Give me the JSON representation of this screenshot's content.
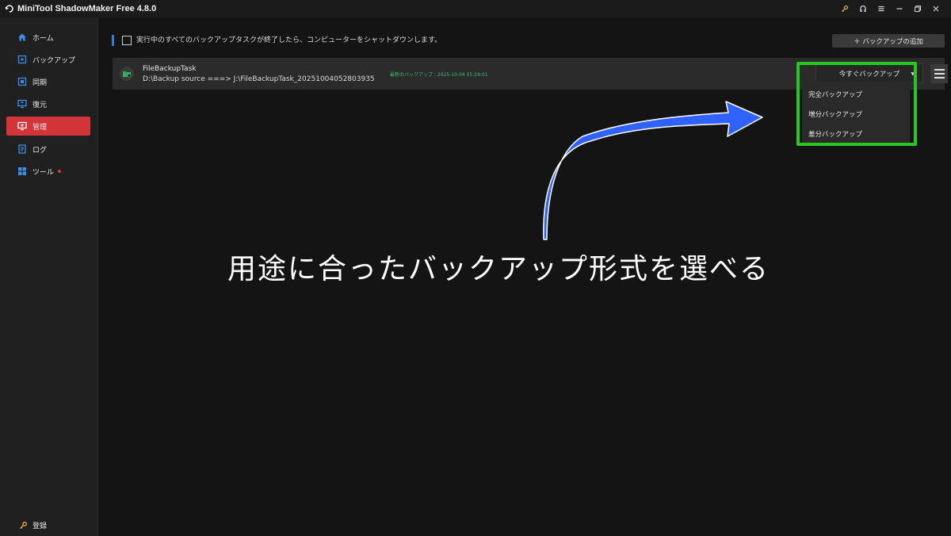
{
  "app": {
    "title": "MiniTool ShadowMaker Free 4.8.0"
  },
  "window_controls": [
    "key-icon",
    "account-icon",
    "menu-icon",
    "minimize-icon",
    "restore-icon",
    "close-icon"
  ],
  "sidebar": {
    "items": [
      {
        "label": "ホーム",
        "icon": "home-icon"
      },
      {
        "label": "バックアップ",
        "icon": "backup-icon"
      },
      {
        "label": "同期",
        "icon": "sync-icon"
      },
      {
        "label": "復元",
        "icon": "restore-icon"
      },
      {
        "label": "管理",
        "icon": "manage-icon",
        "active": true
      },
      {
        "label": "ログ",
        "icon": "log-icon"
      },
      {
        "label": "ツール",
        "icon": "tools-icon",
        "badge": true
      }
    ],
    "register_label": "登録"
  },
  "main": {
    "shutdown_label": "実行中のすべてのバックアップタスクが終了したら、コンピューターをシャットダウンします。",
    "add_backup_label": "＋ バックアップの追加",
    "task": {
      "name": "FileBackupTask",
      "path": "D:\\Backup source ===> J:\\FileBackupTask_20251004052803935",
      "last_backup": "最新のバックアップ : 2025-10-04 05:29:01"
    },
    "backup_now_label": "今すぐバックアップ",
    "dropdown_items": [
      "完全バックアップ",
      "増分バックアップ",
      "差分バックアップ"
    ]
  },
  "annotation": {
    "text": "用途に合ったバックアップ形式を選べる"
  },
  "colors": {
    "accent_red": "#d3343a",
    "highlight_green": "#27c81e",
    "arrow_blue": "#2f62ff",
    "status_green": "#3bbf6a"
  }
}
